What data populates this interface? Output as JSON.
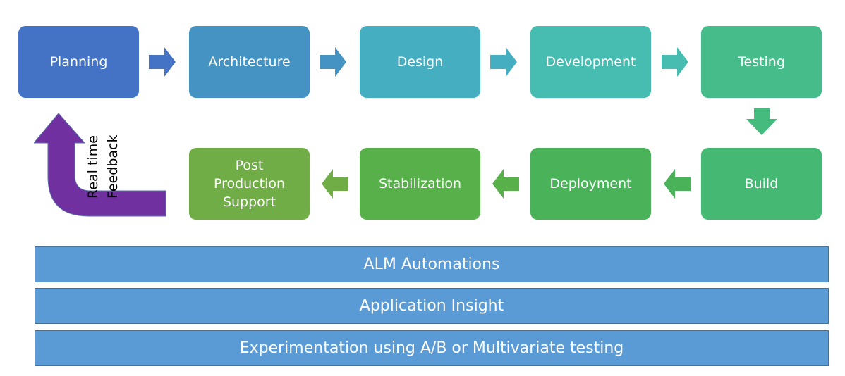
{
  "top_row": [
    {
      "label": "Planning",
      "color": "#4472c4"
    },
    {
      "label": "Architecture",
      "color": "#4493c2"
    },
    {
      "label": "Design",
      "color": "#45aec0"
    },
    {
      "label": "Development",
      "color": "#46bdb0"
    },
    {
      "label": "Testing",
      "color": "#45bc8a"
    }
  ],
  "bottom_row": [
    {
      "label": "Build",
      "color": "#45b873"
    },
    {
      "label": "Deployment",
      "color": "#4ab35a"
    },
    {
      "label": "Stabilization",
      "color": "#58b04a"
    },
    {
      "label": "Post Production Support",
      "color": "#70ad47"
    }
  ],
  "arrows_top": [
    "#4472c4",
    "#4493c2",
    "#45aec0",
    "#46bdb0"
  ],
  "arrow_down": "#45bc7d",
  "arrows_bottom": [
    "#4ab35a",
    "#58b04a",
    "#70ad47"
  ],
  "feedback": {
    "label": "Real time Feedback",
    "line1": "Real time",
    "line2": "Feedback",
    "color": "#7030a0"
  },
  "bars": [
    {
      "label": "ALM Automations"
    },
    {
      "label": "Application Insight"
    },
    {
      "label": "Experimentation using A/B or Multivariate testing"
    }
  ]
}
